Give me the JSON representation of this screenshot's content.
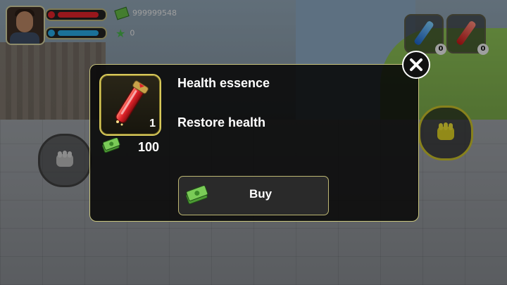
{
  "hud": {
    "money_value": "999999548",
    "star_value": "0",
    "slot_left_count": "0",
    "slot_right_count": "0"
  },
  "dialog": {
    "item_name": "Health essence",
    "item_description": "Restore health",
    "item_count": "1",
    "price": "100",
    "buy_label": "Buy"
  },
  "icons": {
    "item": "red-vial-icon",
    "price": "cash-icon",
    "buy": "cash-icon",
    "close": "close-icon"
  },
  "colors": {
    "accent_border": "#c9c57e",
    "dialog_bg": "#080808",
    "health": "#e0232a",
    "energy": "#27a7e0",
    "cash": "#65b846"
  }
}
